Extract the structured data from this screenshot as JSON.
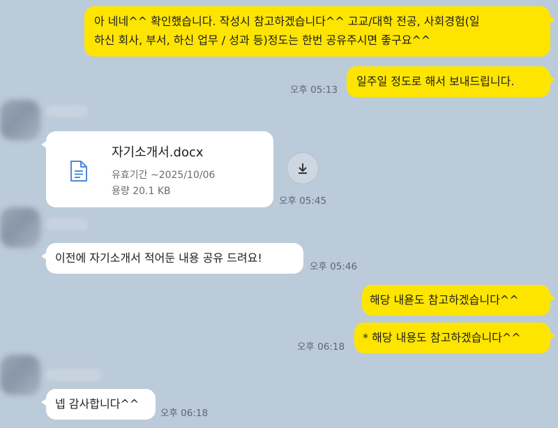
{
  "messages": {
    "m1": "아 네네^^ 확인했습니다. 작성시 참고하겠습니다^^ 고교/대학 전공, 사회경험(일하신 회사, 부서, 하신 업무 / 성과 등)정도는 한번 공유주시면 좋구요^^",
    "m1_line1": "아 네네^^ 확인했습니다. 작성시 참고하겠습니다^^ 고교/대학 전공, 사회경험(일",
    "m1_line2": "하신 회사, 부서, 하신 업무 / 성과 등)정도는 한번 공유주시면 좋구요^^",
    "m2": "일주일 정도로 해서 보내드립니다.",
    "m2_time": "오후 05:13",
    "file": {
      "name": "자기소개서.docx",
      "expiry": "유효기간 ~2025/10/06",
      "size": "용량 20.1 KB",
      "time": "오후 05:45"
    },
    "m3": "이전에 자기소개서 적어둔 내용 공유 드려요!",
    "m3_time": "오후 05:46",
    "m4": "해당 내욛도 참고하겠습니다^^",
    "m5": "* 해당 내용도 참고하겠습니다^^",
    "m5_time": "오후 06:18",
    "m6": "넵 감사합니다^^",
    "m6_time": "오후 06:18"
  },
  "colors": {
    "background": "#bccbd9",
    "my_bubble": "#fee500",
    "their_bubble": "#ffffff",
    "file_icon": "#4a8ad8"
  },
  "icons": {
    "file": "document-icon",
    "download": "download-icon"
  }
}
